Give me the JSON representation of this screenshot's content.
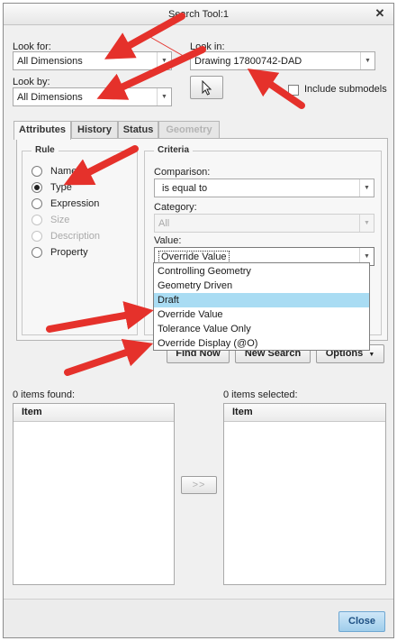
{
  "window": {
    "title": "Search Tool:1"
  },
  "look_for": {
    "label": "Look for:",
    "value": "All Dimensions"
  },
  "look_by": {
    "label": "Look by:",
    "value": "All Dimensions"
  },
  "look_in": {
    "label": "Look in:",
    "value": "Drawing 17800742-DAD"
  },
  "include_submodels": {
    "label": "Include submodels",
    "checked": false
  },
  "tabs": [
    {
      "label": "Attributes",
      "state": "active"
    },
    {
      "label": "History",
      "state": "normal"
    },
    {
      "label": "Status",
      "state": "normal"
    },
    {
      "label": "Geometry",
      "state": "disabled"
    }
  ],
  "rule": {
    "title": "Rule",
    "options": [
      {
        "label": "Name",
        "checked": false,
        "enabled": true
      },
      {
        "label": "Type",
        "checked": true,
        "enabled": true
      },
      {
        "label": "Expression",
        "checked": false,
        "enabled": true
      },
      {
        "label": "Size",
        "checked": false,
        "enabled": false
      },
      {
        "label": "Description",
        "checked": false,
        "enabled": false
      },
      {
        "label": "Property",
        "checked": false,
        "enabled": true
      }
    ]
  },
  "criteria": {
    "title": "Criteria",
    "comparison": {
      "label": "Comparison:",
      "value": "is equal to"
    },
    "category": {
      "label": "Category:",
      "value": "All"
    },
    "value": {
      "label": "Value:",
      "value": "Override Value"
    },
    "dropdown_options": [
      "Controlling Geometry",
      "Geometry Driven",
      "Draft",
      "Override Value",
      "Tolerance Value Only",
      "Override Display (@O)"
    ],
    "dropdown_highlighted": "Draft"
  },
  "actions": {
    "find_now": "Find Now",
    "new_search": "New Search",
    "options": "Options"
  },
  "results": {
    "found_label": "0 items found:",
    "selected_label": "0 items selected:",
    "column_header": "Item",
    "transfer_button": ">>"
  },
  "footer": {
    "close": "Close"
  },
  "colors": {
    "annotation_arrow": "#e5312b",
    "highlight": "#a9dcf3",
    "close_button": "#9fcdeb"
  },
  "icons": {
    "window_close": "close-icon",
    "pointer": "cursor-arrow-icon"
  }
}
